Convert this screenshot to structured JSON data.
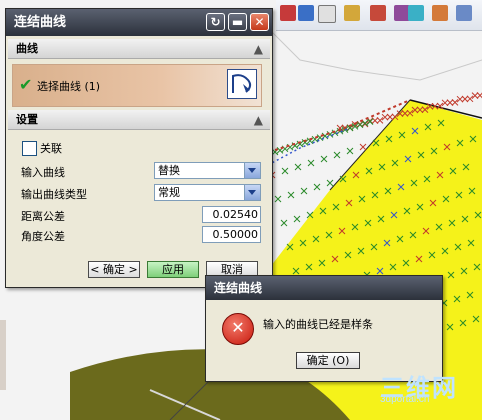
{
  "dialog": {
    "title": "连结曲线",
    "section_curve": "曲线",
    "select_curve": "选择曲线 (1)",
    "section_settings": "设置",
    "associative_label": "关联",
    "input_curve_label": "输入曲线",
    "input_curve_value": "替换",
    "output_type_label": "输出曲线类型",
    "output_type_value": "常规",
    "distance_tol_label": "距离公差",
    "distance_tol_value": "0.02540",
    "angle_tol_label": "角度公差",
    "angle_tol_value": "0.50000",
    "ok_label": "< 确定 >",
    "apply_label": "应用",
    "cancel_label": "取消"
  },
  "message": {
    "title": "连结曲线",
    "text": "输入的曲线已经是样条",
    "ok_label": "确定 (O)"
  },
  "watermark": {
    "big": "三维网",
    "small": "3dportal.cn"
  },
  "colors": {
    "model_yellow": "#f5f21a",
    "model_olive": "#6b6a1c",
    "hatch_green": "#2a8a2a",
    "hatch_red": "#c0392b",
    "hatch_blue": "#3355cc"
  }
}
